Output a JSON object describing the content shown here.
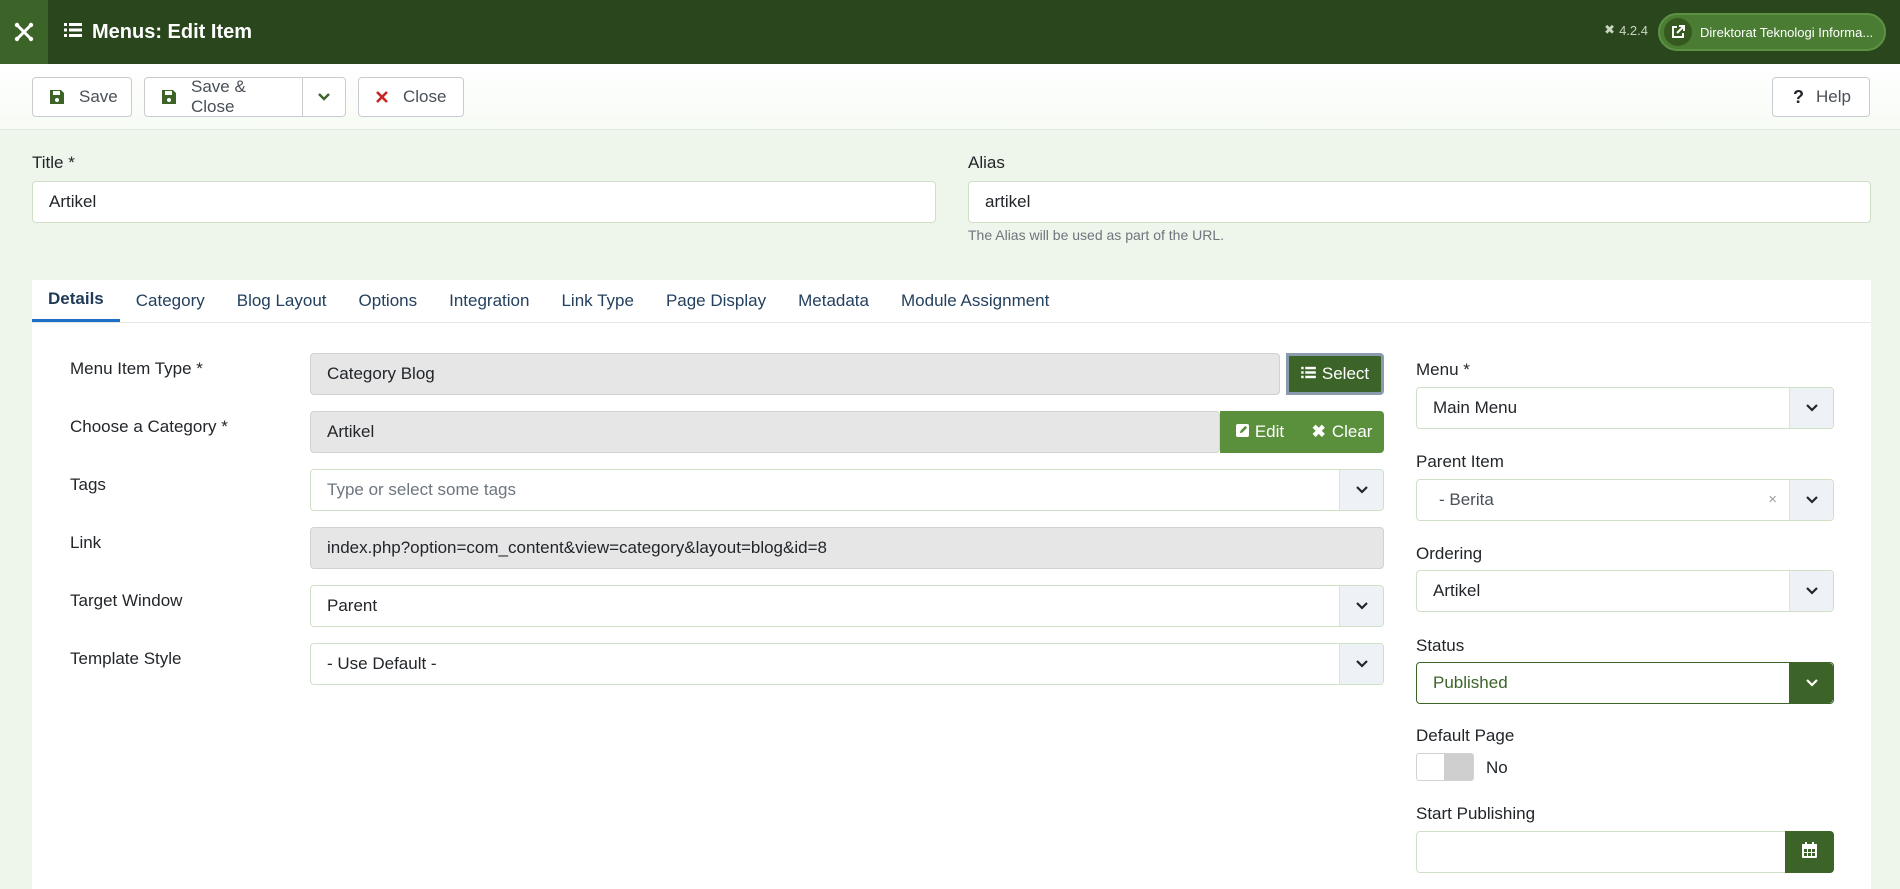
{
  "header": {
    "title": "Menus: Edit Item",
    "version": "4.2.4",
    "site_name": "Direktorat Teknologi Informa..."
  },
  "toolbar": {
    "save": "Save",
    "save_close": "Save & Close",
    "close": "Close",
    "help": "Help"
  },
  "form": {
    "title_label": "Title *",
    "title_value": "Artikel",
    "alias_label": "Alias",
    "alias_value": "artikel",
    "alias_help": "The Alias will be used as part of the URL."
  },
  "tabs": [
    "Details",
    "Category",
    "Blog Layout",
    "Options",
    "Integration",
    "Link Type",
    "Page Display",
    "Metadata",
    "Module Assignment"
  ],
  "details": {
    "menu_item_type_label": "Menu Item Type *",
    "menu_item_type_value": "Category Blog",
    "select_button": "Select",
    "category_label": "Choose a Category *",
    "category_value": "Artikel",
    "edit_button": "Edit",
    "clear_button": "Clear",
    "tags_label": "Tags",
    "tags_placeholder": "Type or select some tags",
    "link_label": "Link",
    "link_value": "index.php?option=com_content&view=category&layout=blog&id=8",
    "target_label": "Target Window",
    "target_value": "Parent",
    "template_label": "Template Style",
    "template_value": "- Use Default -"
  },
  "sidebar": {
    "menu_label": "Menu *",
    "menu_value": "Main Menu",
    "parent_label": "Parent Item",
    "parent_value": "- Berita",
    "ordering_label": "Ordering",
    "ordering_value": "Artikel",
    "status_label": "Status",
    "status_value": "Published",
    "default_label": "Default Page",
    "default_value": "No",
    "start_label": "Start Publishing",
    "start_value": ""
  },
  "colors": {
    "header_bg": "#2a461d",
    "primary_green": "#3c6428",
    "button_green": "#5a8f3c"
  }
}
